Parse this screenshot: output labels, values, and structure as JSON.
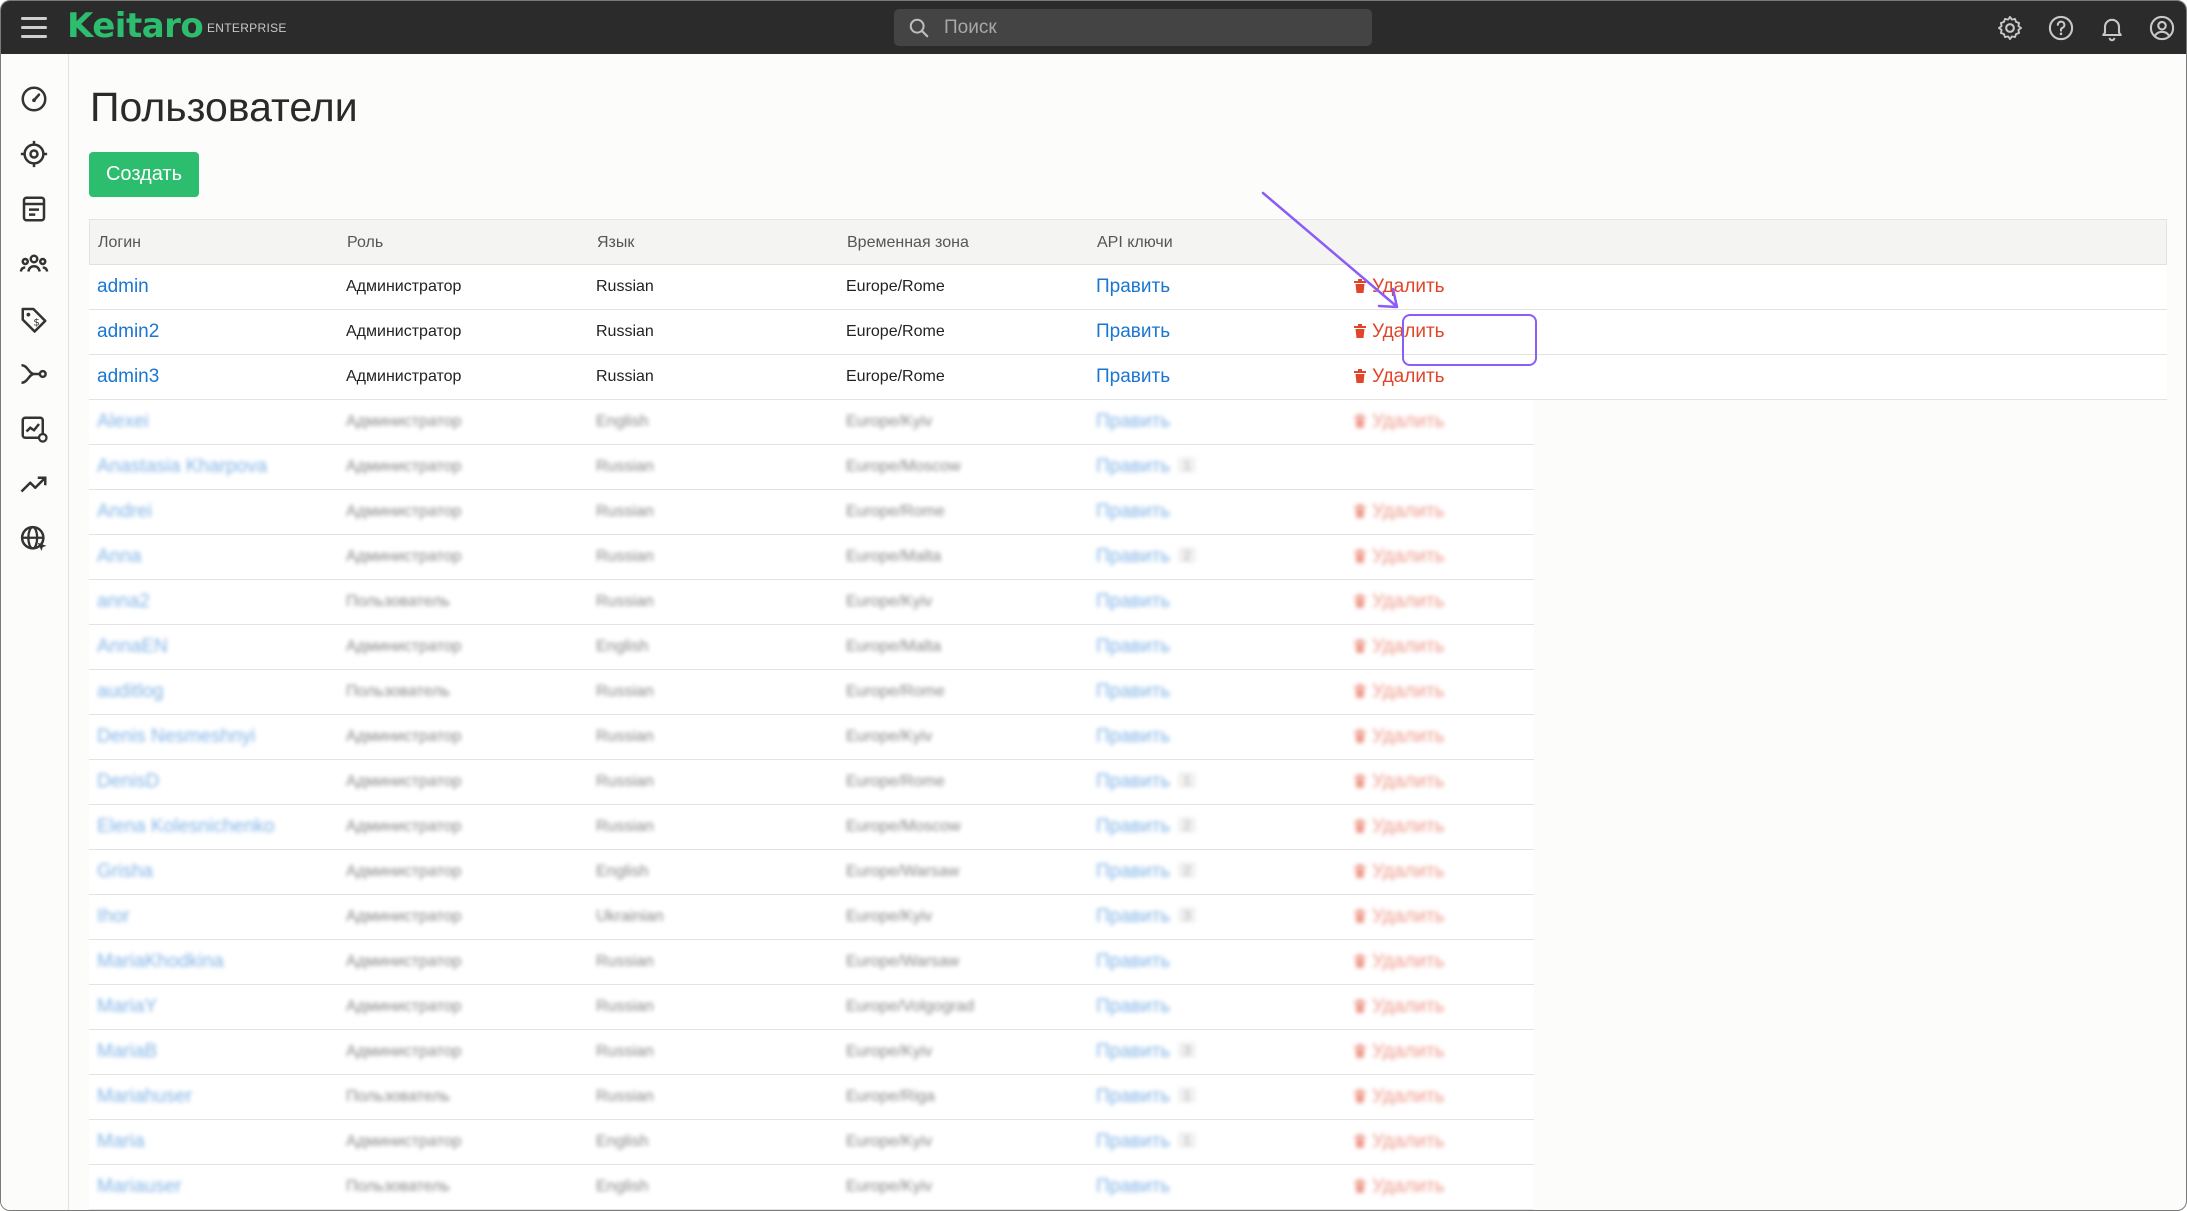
{
  "header": {
    "logo": "Keitaro",
    "edition": "ENTERPRISE",
    "search_placeholder": "Поиск"
  },
  "page": {
    "title": "Пользователи",
    "create_label": "Создать"
  },
  "table": {
    "columns": [
      "Логин",
      "Роль",
      "Язык",
      "Временная зона",
      "API ключи"
    ],
    "edit_label": "Править",
    "delete_label": "Удалить",
    "rows": [
      {
        "login": "admin",
        "role": "Администратор",
        "lang": "Russian",
        "tz": "Europe/Rome",
        "keys": "",
        "delete": true
      },
      {
        "login": "admin2",
        "role": "Администратор",
        "lang": "Russian",
        "tz": "Europe/Rome",
        "keys": "",
        "delete": true
      },
      {
        "login": "admin3",
        "role": "Администратор",
        "lang": "Russian",
        "tz": "Europe/Rome",
        "keys": "",
        "delete": true
      },
      {
        "login": "Alexei",
        "role": "Администратор",
        "lang": "English",
        "tz": "Europe/Kyiv",
        "keys": "",
        "delete": true
      },
      {
        "login": "Anastasia Kharpova",
        "role": "Администратор",
        "lang": "Russian",
        "tz": "Europe/Moscow",
        "keys": "1",
        "delete": false
      },
      {
        "login": "Andrei",
        "role": "Администратор",
        "lang": "Russian",
        "tz": "Europe/Rome",
        "keys": "",
        "delete": true
      },
      {
        "login": "Anna",
        "role": "Администратор",
        "lang": "Russian",
        "tz": "Europe/Malta",
        "keys": "2",
        "delete": true
      },
      {
        "login": "anna2",
        "role": "Пользователь",
        "lang": "Russian",
        "tz": "Europe/Kyiv",
        "keys": "",
        "delete": true
      },
      {
        "login": "AnnaEN",
        "role": "Администратор",
        "lang": "English",
        "tz": "Europe/Malta",
        "keys": "",
        "delete": true
      },
      {
        "login": "auditlog",
        "role": "Пользователь",
        "lang": "Russian",
        "tz": "Europe/Rome",
        "keys": "",
        "delete": true
      },
      {
        "login": "Denis Nesmeshnyi",
        "role": "Администратор",
        "lang": "Russian",
        "tz": "Europe/Kyiv",
        "keys": "",
        "delete": true
      },
      {
        "login": "DenisD",
        "role": "Администратор",
        "lang": "Russian",
        "tz": "Europe/Rome",
        "keys": "1",
        "delete": true
      },
      {
        "login": "Elena Kolesnichenko",
        "role": "Администратор",
        "lang": "Russian",
        "tz": "Europe/Moscow",
        "keys": "2",
        "delete": true
      },
      {
        "login": "Grisha",
        "role": "Администратор",
        "lang": "English",
        "tz": "Europe/Warsaw",
        "keys": "2",
        "delete": true
      },
      {
        "login": "Ihor",
        "role": "Администратор",
        "lang": "Ukrainian",
        "tz": "Europe/Kyiv",
        "keys": "3",
        "delete": true
      },
      {
        "login": "MariaKhodkina",
        "role": "Администратор",
        "lang": "Russian",
        "tz": "Europe/Warsaw",
        "keys": "",
        "delete": true
      },
      {
        "login": "MariaY",
        "role": "Администратор",
        "lang": "Russian",
        "tz": "Europe/Volgograd",
        "keys": "",
        "delete": true
      },
      {
        "login": "MariaB",
        "role": "Администратор",
        "lang": "Russian",
        "tz": "Europe/Kyiv",
        "keys": "3",
        "delete": true
      },
      {
        "login": "Mariahuser",
        "role": "Пользователь",
        "lang": "Russian",
        "tz": "Europe/Riga",
        "keys": "1",
        "delete": true
      },
      {
        "login": "Maria",
        "role": "Администратор",
        "lang": "English",
        "tz": "Europe/Kyiv",
        "keys": "1",
        "delete": true
      },
      {
        "login": "Mariauser",
        "role": "Пользователь",
        "lang": "English",
        "tz": "Europe/Kyiv",
        "keys": "",
        "delete": true
      }
    ]
  },
  "colors": {
    "brand": "#2dbd6e",
    "link": "#1a76d2",
    "danger": "#e0452a",
    "highlight": "#8b5cf6",
    "topbar": "#2b2b2b"
  },
  "icons": {
    "top": [
      "settings-icon",
      "help-icon",
      "bell-icon",
      "account-icon"
    ],
    "sidebar": [
      "dashboard-icon",
      "campaigns-icon",
      "landing-pages-icon",
      "users-group-icon",
      "offers-icon",
      "flows-icon",
      "reports-icon",
      "trends-icon",
      "domains-icon"
    ]
  }
}
